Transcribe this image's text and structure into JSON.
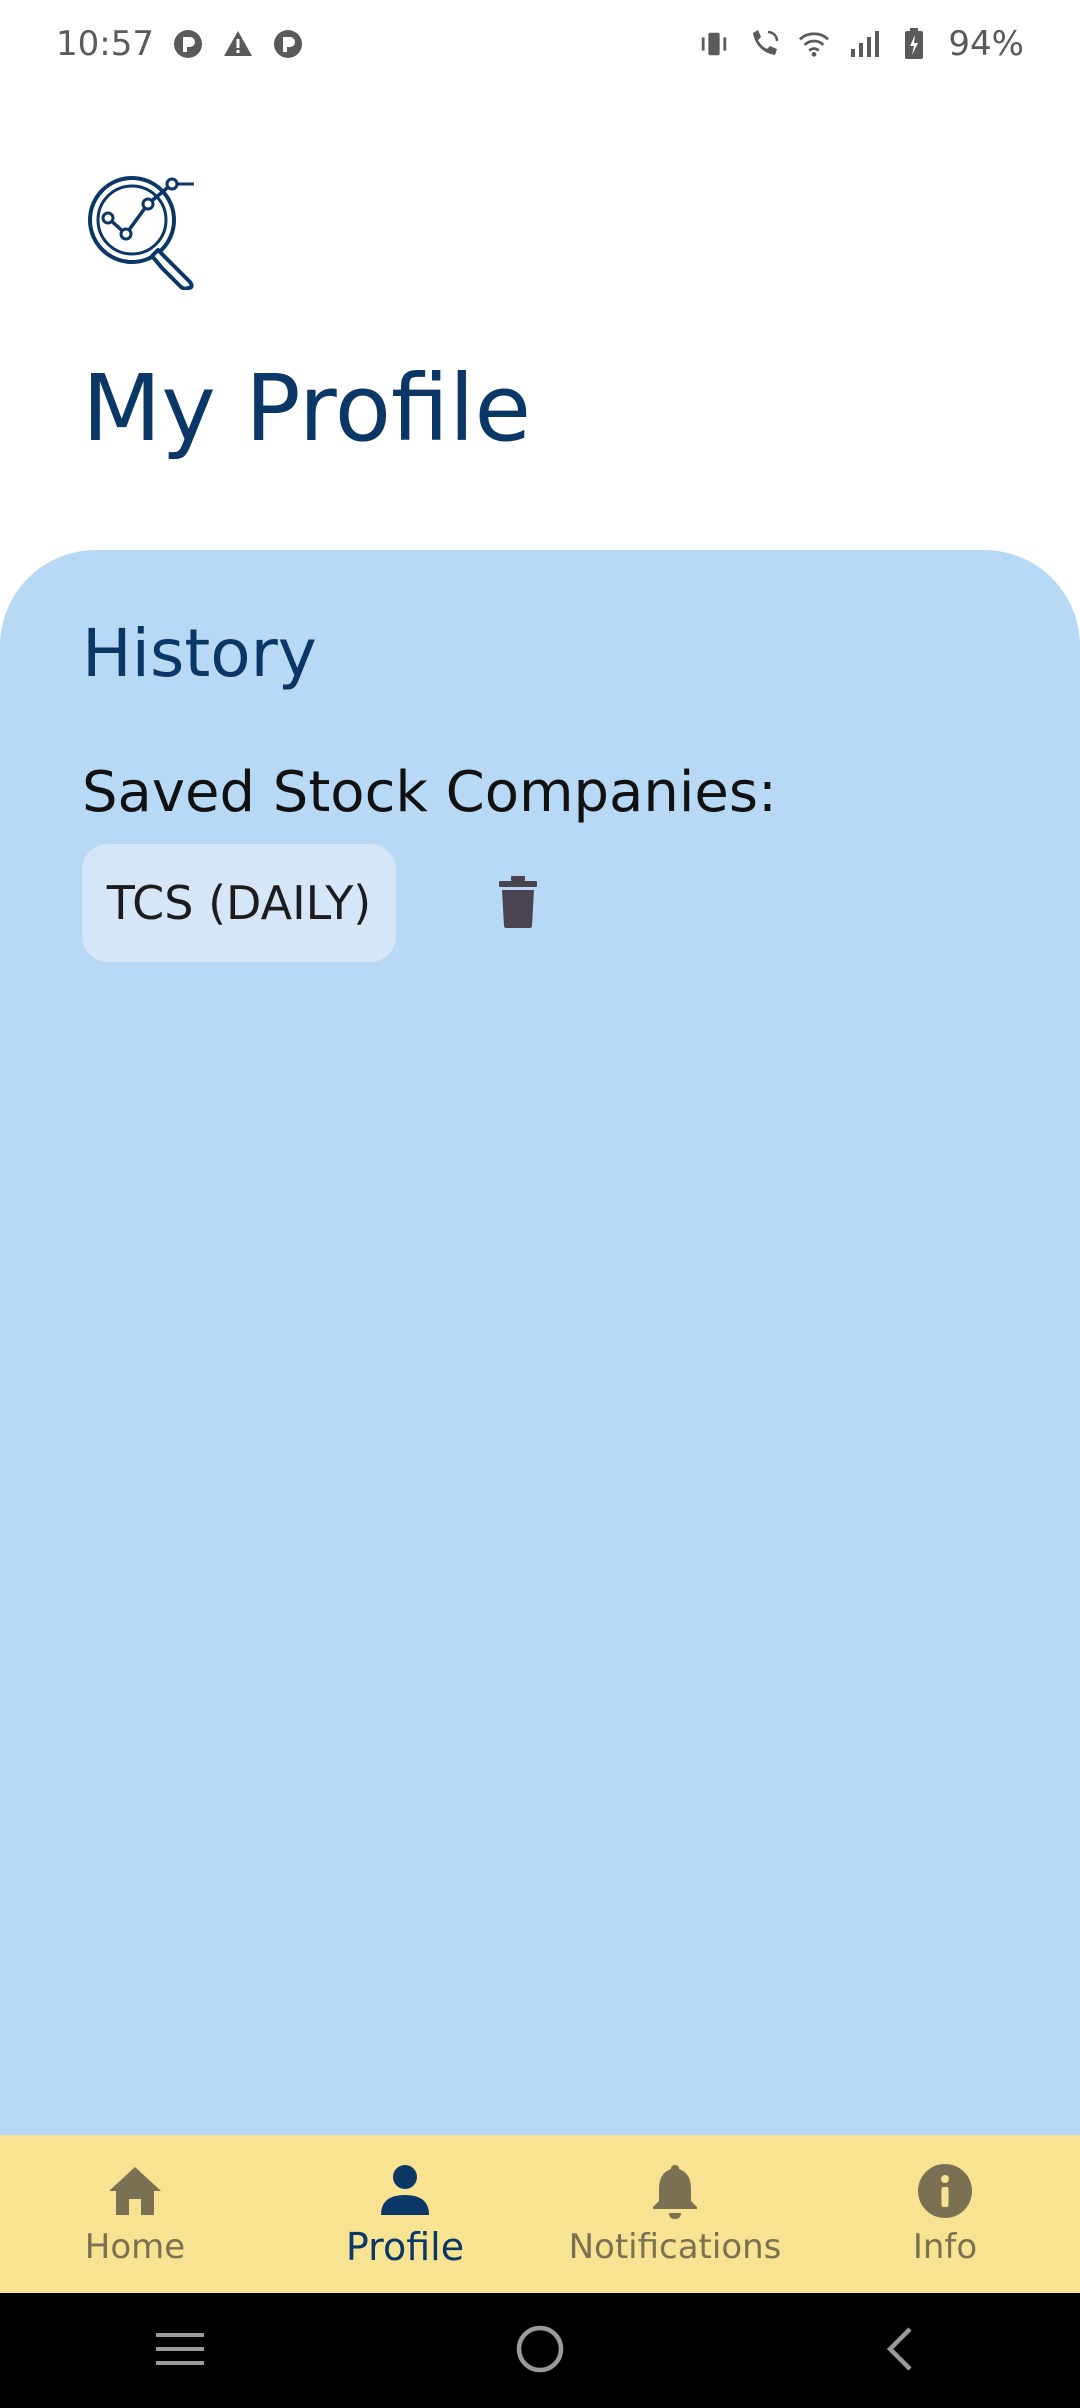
{
  "status_bar": {
    "time": "10:57",
    "battery": "94%",
    "left_icons": [
      "app-notification-icon",
      "warning-icon",
      "app-notification-icon"
    ],
    "right_icons": [
      "vibrate-icon",
      "wifi-calling-icon",
      "wifi-icon",
      "signal-icon",
      "battery-icon"
    ]
  },
  "header": {
    "logo_icon": "analytics-search-icon",
    "title": "My Profile"
  },
  "history": {
    "title": "History",
    "saved_label": "Saved Stock Companies:",
    "companies": [
      {
        "label": "TCS (DAILY)",
        "action_icon": "trash-icon"
      }
    ]
  },
  "bottom_nav": {
    "items": [
      {
        "label": "Home",
        "icon": "home-icon"
      },
      {
        "label": "Profile",
        "icon": "person-icon",
        "active": true
      },
      {
        "label": "Notifications",
        "icon": "bell-icon"
      },
      {
        "label": "Info",
        "icon": "info-icon"
      }
    ]
  },
  "colors": {
    "primary": "#0b3766",
    "panel": "#b7d9f6",
    "chip": "#d4e6f8",
    "nav_bg": "#f7e391",
    "nav_inactive": "#7a7152"
  }
}
